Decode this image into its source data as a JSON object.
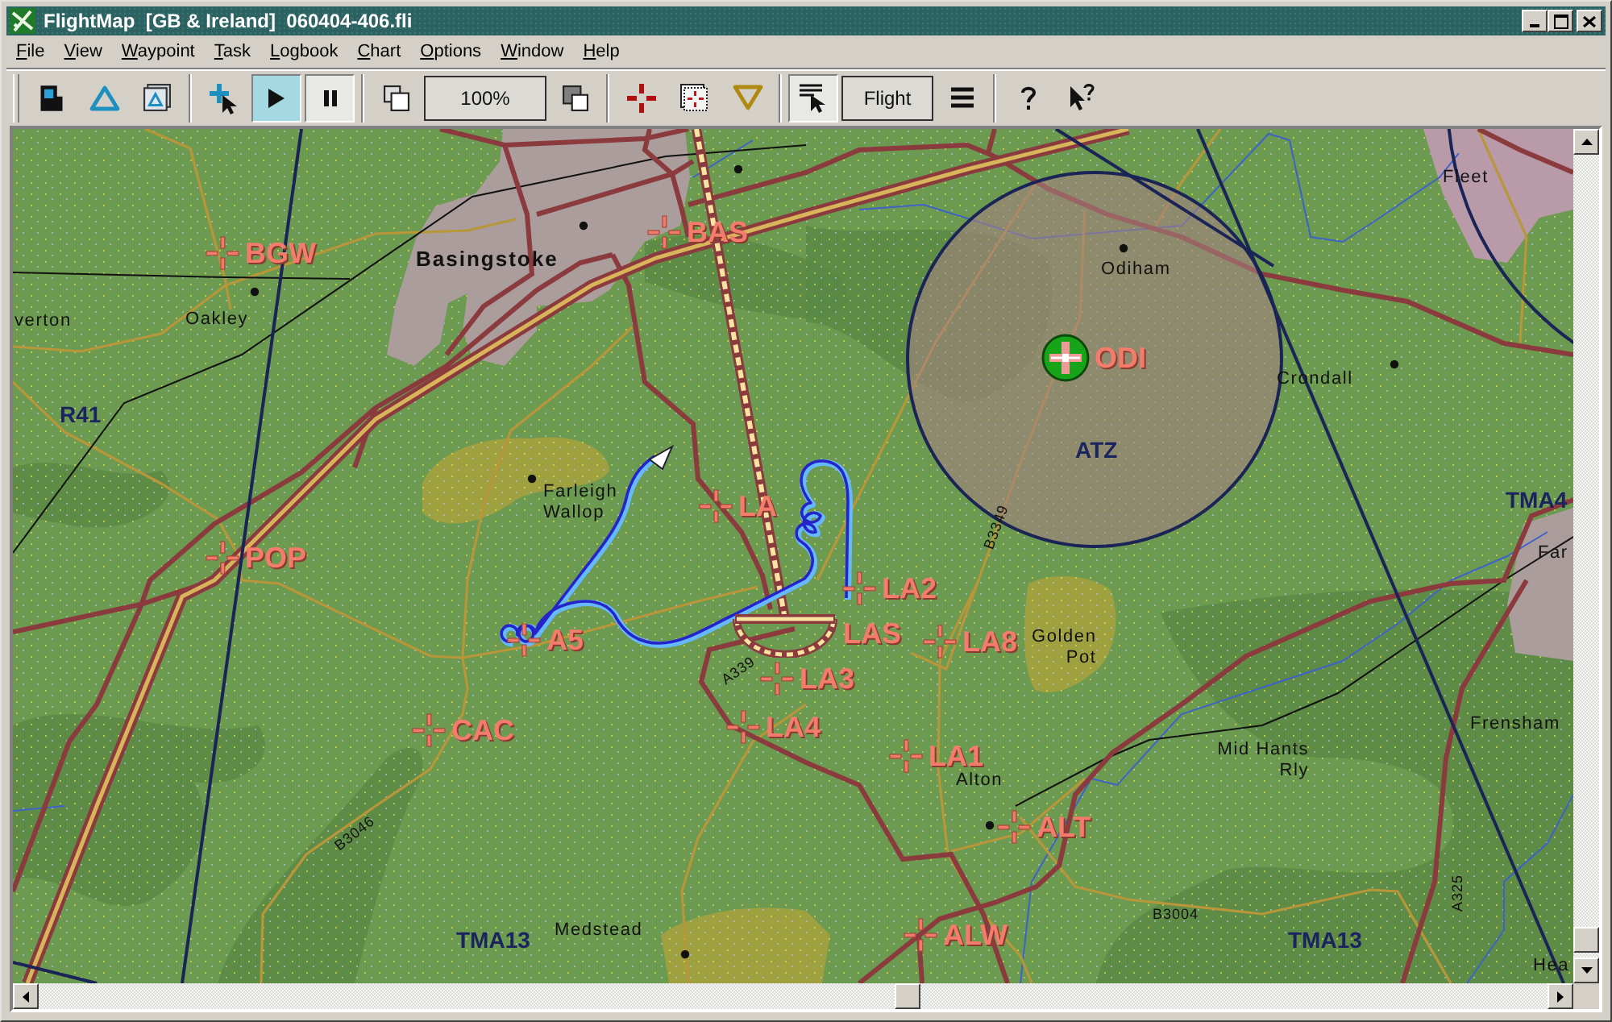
{
  "window": {
    "title": "FlightMap  [GB & Ireland]  060404-406.fli"
  },
  "menu": [
    "File",
    "View",
    "Waypoint",
    "Task",
    "Logbook",
    "Chart",
    "Options",
    "Window",
    "Help"
  ],
  "toolbar": [
    {
      "items": [
        {
          "kind": "button",
          "selected": false,
          "pressed": false
        },
        {
          "kind": "button",
          "selected": false,
          "pressed": false
        },
        {
          "kind": "button",
          "selected": false,
          "pressed": false
        }
      ]
    },
    {
      "items": [
        {
          "kind": "button",
          "selected": false,
          "pressed": false
        },
        {
          "kind": "button",
          "selected": true,
          "pressed": false
        },
        {
          "kind": "button",
          "selected": false,
          "pressed": true
        }
      ]
    },
    {
      "items": [
        {
          "kind": "button",
          "selected": false,
          "pressed": false
        },
        {
          "kind": "field",
          "value": "100%"
        },
        {
          "kind": "button",
          "selected": false,
          "pressed": false
        }
      ]
    },
    {
      "items": [
        {
          "kind": "button",
          "selected": false,
          "pressed": false
        },
        {
          "kind": "button",
          "selected": false,
          "pressed": false
        },
        {
          "kind": "button",
          "selected": false,
          "pressed": false
        }
      ]
    },
    {
      "items": [
        {
          "kind": "button",
          "selected": false,
          "pressed": true
        },
        {
          "kind": "field",
          "value": "Flight"
        },
        {
          "kind": "button",
          "selected": false,
          "pressed": false
        }
      ]
    },
    {
      "items": [
        {
          "kind": "button",
          "selected": false,
          "pressed": false
        },
        {
          "kind": "button",
          "selected": false,
          "pressed": false
        }
      ]
    }
  ],
  "map": {
    "labels": [
      {
        "kind": "town",
        "text": "Basingstoke"
      },
      {
        "kind": "village",
        "text": "verton"
      },
      {
        "kind": "village",
        "text": "Oakley"
      },
      {
        "kind": "village",
        "text": "Farleigh Wallop"
      },
      {
        "kind": "village",
        "text": "Odiham"
      },
      {
        "kind": "airspace",
        "text": "ATZ"
      },
      {
        "kind": "village",
        "text": "Crondall"
      },
      {
        "kind": "village",
        "text": "Fleet"
      },
      {
        "kind": "airspace",
        "text": "TMA4"
      },
      {
        "kind": "village",
        "text": "Far"
      },
      {
        "kind": "village",
        "text": "Golden Pot"
      },
      {
        "kind": "airspace",
        "text": "R41"
      },
      {
        "kind": "road",
        "text": "A339"
      },
      {
        "kind": "road",
        "text": "B3349"
      },
      {
        "kind": "village",
        "text": "Mid Hants Rly"
      },
      {
        "kind": "village",
        "text": "Frensham"
      },
      {
        "kind": "village",
        "text": "Alton"
      },
      {
        "kind": "road",
        "text": "B3046"
      },
      {
        "kind": "airspace",
        "text": "TMA13"
      },
      {
        "kind": "village",
        "text": "Medstead"
      },
      {
        "kind": "road",
        "text": "B3004"
      },
      {
        "kind": "airspace",
        "text": "TMA13"
      },
      {
        "kind": "road",
        "text": "A325"
      },
      {
        "kind": "village",
        "text": "Hea"
      }
    ],
    "waypoints": [
      {
        "kind": "turnpoint",
        "label": "BGW"
      },
      {
        "kind": "turnpoint",
        "label": "BAS"
      },
      {
        "kind": "airfield",
        "label": "ODI"
      },
      {
        "kind": "turnpoint",
        "label": "POP"
      },
      {
        "kind": "turnpoint",
        "label": "LA"
      },
      {
        "kind": "turnpoint",
        "label": "LA2"
      },
      {
        "kind": "turnpoint",
        "label": "A5"
      },
      {
        "kind": "strip",
        "label": "LAS"
      },
      {
        "kind": "turnpoint",
        "label": "LA8"
      },
      {
        "kind": "turnpoint",
        "label": "LA3"
      },
      {
        "kind": "turnpoint",
        "label": "CAC"
      },
      {
        "kind": "turnpoint",
        "label": "LA4"
      },
      {
        "kind": "turnpoint",
        "label": "LA1"
      },
      {
        "kind": "turnpoint",
        "label": "ALT"
      },
      {
        "kind": "turnpoint",
        "label": "ALW"
      }
    ]
  }
}
